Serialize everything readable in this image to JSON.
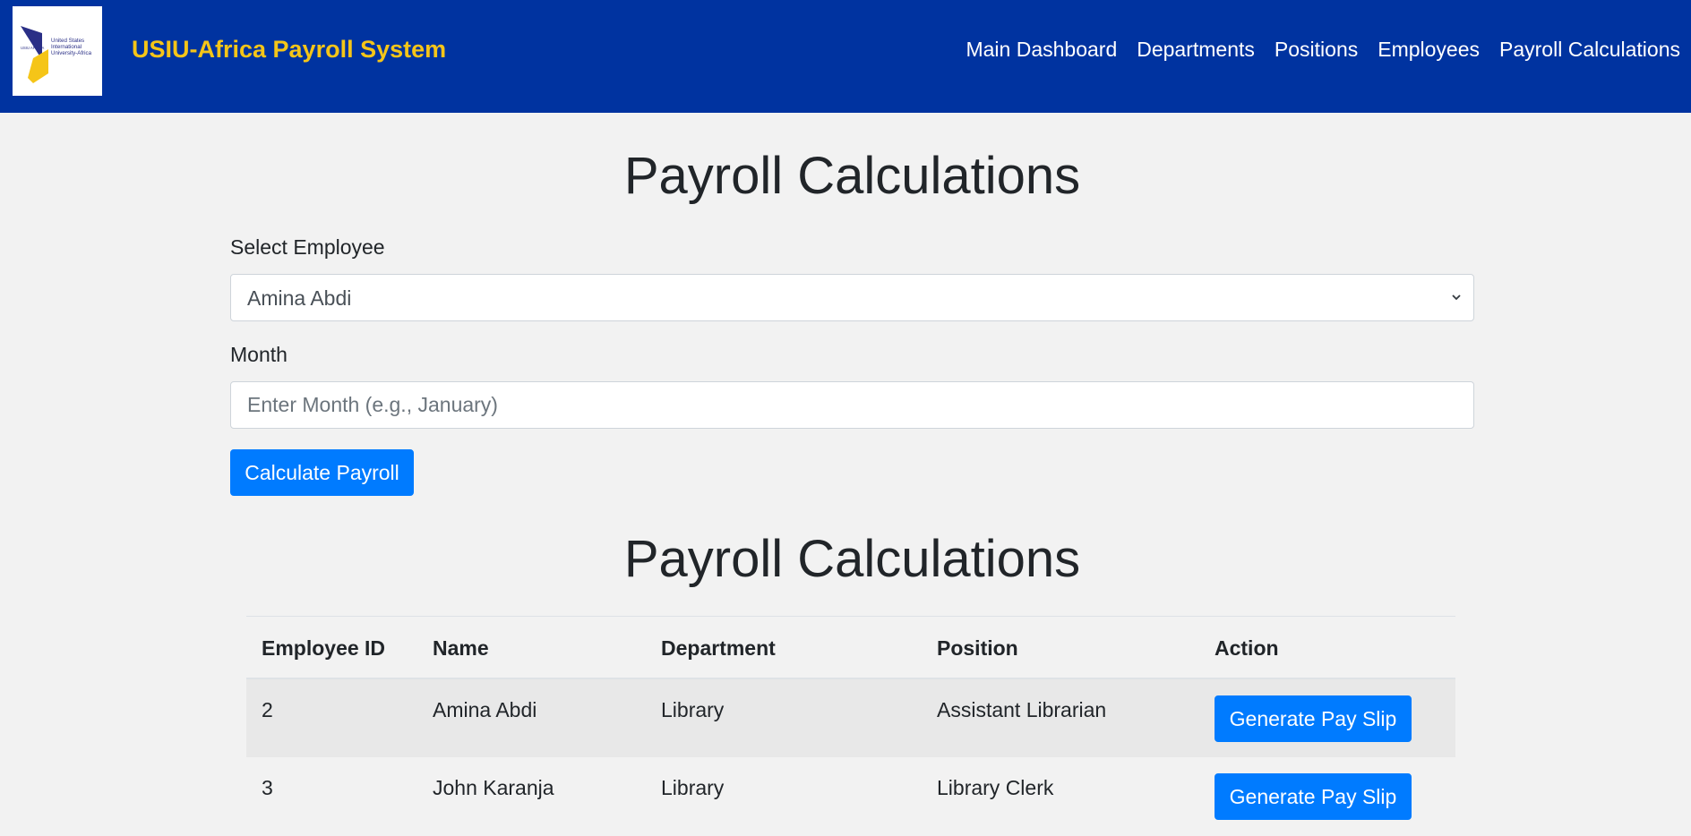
{
  "header": {
    "logo_text": [
      "United States",
      "International",
      "University-Africa",
      "USIU AFRICA"
    ],
    "app_title": "USIU-Africa Payroll System",
    "nav": [
      {
        "label": "Main Dashboard"
      },
      {
        "label": "Departments"
      },
      {
        "label": "Positions"
      },
      {
        "label": "Employees"
      },
      {
        "label": "Payroll Calculations"
      }
    ]
  },
  "colors": {
    "header_bg": "#0033a0",
    "brand_yellow": "#f5c518",
    "primary_button": "#007bff"
  },
  "form": {
    "heading": "Payroll Calculations",
    "employee_label": "Select Employee",
    "employee_selected": "Amina Abdi",
    "month_label": "Month",
    "month_placeholder": "Enter Month (e.g., January)",
    "calculate_button": "Calculate Payroll"
  },
  "table_section": {
    "heading": "Payroll Calculations",
    "columns": [
      "Employee ID",
      "Name",
      "Department",
      "Position",
      "Action"
    ],
    "rows": [
      {
        "id": "2",
        "name": "Amina Abdi",
        "department": "Library",
        "position": "Assistant Librarian",
        "action": "Generate Pay Slip"
      },
      {
        "id": "3",
        "name": "John Karanja",
        "department": "Library",
        "position": "Library Clerk",
        "action": "Generate Pay Slip"
      }
    ]
  },
  "icons": {
    "select_caret": "chevron-down-icon",
    "logo": "usiu-logo-icon"
  }
}
